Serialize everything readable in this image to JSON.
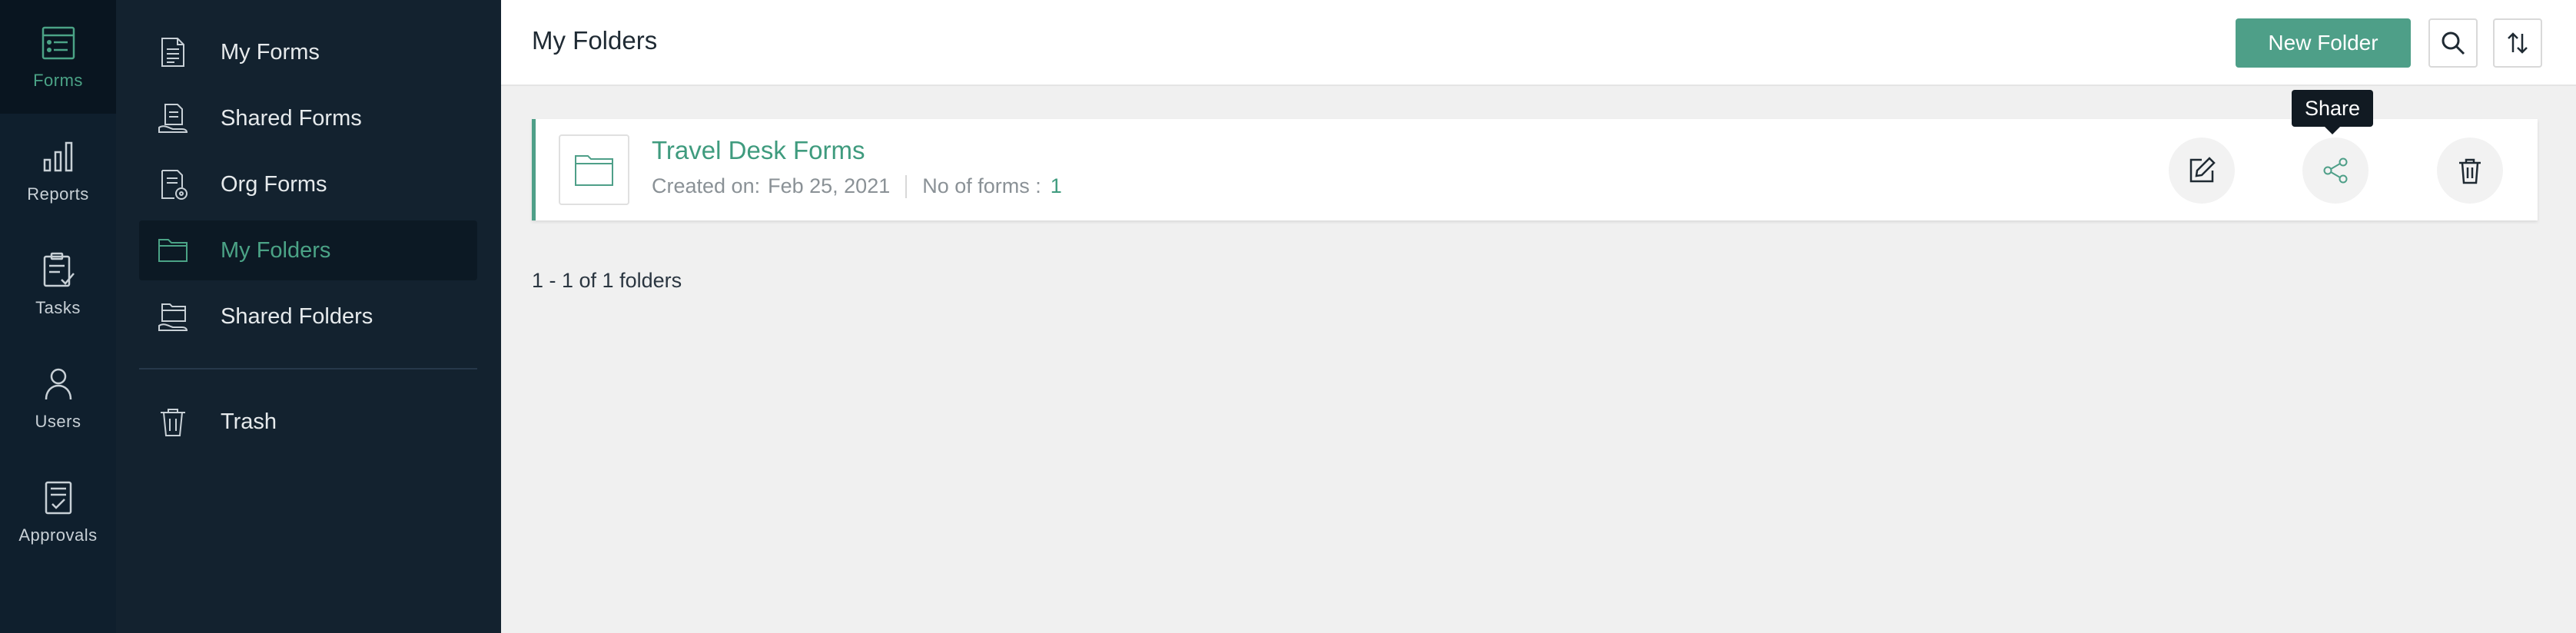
{
  "rail": {
    "items": [
      {
        "label": "Forms",
        "icon": "forms-icon",
        "active": true
      },
      {
        "label": "Reports",
        "icon": "reports-icon"
      },
      {
        "label": "Tasks",
        "icon": "tasks-icon"
      },
      {
        "label": "Users",
        "icon": "users-icon"
      },
      {
        "label": "Approvals",
        "icon": "approvals-icon"
      }
    ]
  },
  "sidebar": {
    "items": [
      {
        "label": "My Forms",
        "icon": "my-forms-icon"
      },
      {
        "label": "Shared Forms",
        "icon": "shared-forms-icon"
      },
      {
        "label": "Org Forms",
        "icon": "org-forms-icon"
      },
      {
        "label": "My Folders",
        "icon": "folder-icon",
        "active": true
      },
      {
        "label": "Shared Folders",
        "icon": "shared-folders-icon"
      },
      {
        "label": "Trash",
        "icon": "trash-icon"
      }
    ]
  },
  "header": {
    "title": "My Folders",
    "new_folder_label": "New Folder",
    "search_icon": "search-icon",
    "sort_icon": "sort-icon"
  },
  "folder": {
    "name": "Travel Desk Forms",
    "created_label": "Created on:",
    "created_date": "Feb 25, 2021",
    "forms_label": "No of forms :",
    "forms_count": "1",
    "actions": [
      "edit-icon",
      "share-icon",
      "delete-icon"
    ]
  },
  "tooltip": {
    "text": "Share"
  },
  "pager": {
    "text": "1 - 1 of 1 folders"
  },
  "colors": {
    "accent": "#4e9f88",
    "rail_bg": "#0f1f2d",
    "sidebar_bg": "#13222f"
  }
}
